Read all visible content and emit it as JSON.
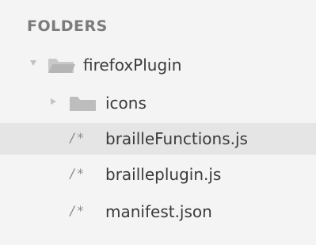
{
  "sidebar": {
    "header": "FOLDERS",
    "tree": {
      "root": {
        "label": "firefoxPlugin",
        "icon": "folder-open-icon",
        "expanded": true
      },
      "folders": [
        {
          "label": "icons",
          "icon": "folder-closed-icon",
          "expanded": false
        }
      ],
      "files": [
        {
          "label": "brailleFunctions.js",
          "icon": "file-js-icon",
          "glyph": "/*",
          "selected": true
        },
        {
          "label": "brailleplugin.js",
          "icon": "file-js-icon",
          "glyph": "/*",
          "selected": false
        },
        {
          "label": "manifest.json",
          "icon": "file-json-icon",
          "glyph": "/*",
          "selected": false
        }
      ]
    },
    "colors": {
      "background": "#f4f4f4",
      "selected_row": "#e5e5e5",
      "header_text": "#7b7b7b",
      "item_text": "#3b3b3b",
      "folder_icon": "#bdbdbd"
    }
  }
}
